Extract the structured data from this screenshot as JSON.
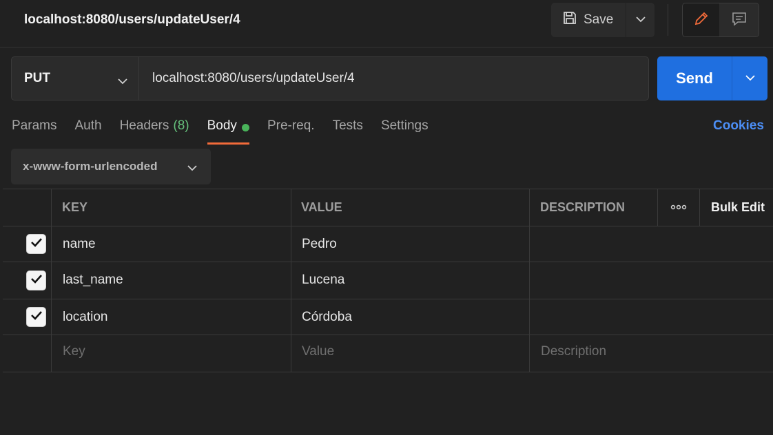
{
  "header": {
    "title": "localhost:8080/users/updateUser/4",
    "save_label": "Save"
  },
  "request": {
    "method": "PUT",
    "url": "localhost:8080/users/updateUser/4",
    "send_label": "Send"
  },
  "tabs": [
    {
      "label": "Params"
    },
    {
      "label": "Auth"
    },
    {
      "label": "Headers",
      "count": "(8)"
    },
    {
      "label": "Body"
    },
    {
      "label": "Pre-req."
    },
    {
      "label": "Tests"
    },
    {
      "label": "Settings"
    }
  ],
  "cookies_label": "Cookies",
  "body_type": "x-www-form-urlencoded",
  "table": {
    "headers": {
      "key": "KEY",
      "value": "VALUE",
      "description": "DESCRIPTION",
      "bulk_edit": "Bulk Edit"
    },
    "rows": [
      {
        "key": "name",
        "value": "Pedro",
        "description": ""
      },
      {
        "key": "last_name",
        "value": "Lucena",
        "description": ""
      },
      {
        "key": "location",
        "value": "Córdoba",
        "description": ""
      }
    ],
    "placeholder": {
      "key": "Key",
      "value": "Value",
      "description": "Description"
    }
  },
  "colors": {
    "accent_orange": "#f26b3a",
    "send_blue": "#1f6fe0",
    "link_blue": "#4c8ef5",
    "status_green": "#49b35a"
  }
}
